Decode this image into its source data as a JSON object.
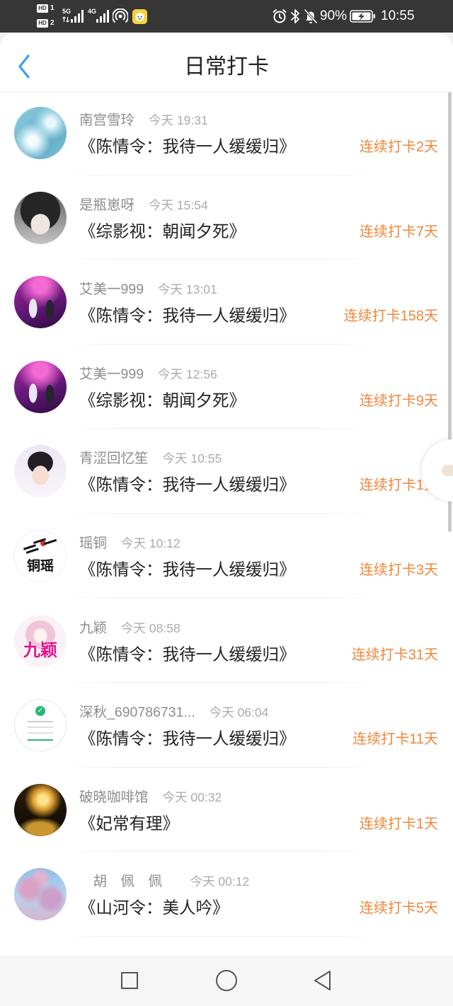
{
  "status_bar": {
    "sim1_badge": "HD",
    "sim1_number": "1",
    "sim2_badge": "HD",
    "sim2_number": "2",
    "sim1_network": "5G",
    "sim2_network": "4G",
    "battery_level": "90%",
    "clock": "10:55",
    "icons": [
      "signal-icon",
      "hotspot-icon",
      "app-notification-icon",
      "alarm-icon",
      "bluetooth-icon",
      "mute-icon",
      "battery-charging-icon"
    ]
  },
  "header": {
    "back_icon": "chevron-left-icon",
    "title": "日常打卡"
  },
  "items": [
    {
      "name": "南宫雪玲",
      "time": "今天 19:31",
      "book": "《陈情令：我待一人缓缓归》",
      "streak": "连续打卡2天"
    },
    {
      "name": "是瓶崽呀",
      "time": "今天 15:54",
      "book": "《综影视：朝闻夕死》",
      "streak": "连续打卡7天"
    },
    {
      "name": "艾美一999",
      "time": "今天 13:01",
      "book": "《陈情令：我待一人缓缓归》",
      "streak": "连续打卡158天"
    },
    {
      "name": "艾美一999",
      "time": "今天 12:56",
      "book": "《综影视：朝闻夕死》",
      "streak": "连续打卡9天"
    },
    {
      "name": "青涩回忆笙",
      "time": "今天 10:55",
      "book": "《陈情令：我待一人缓缓归》",
      "streak": "连续打卡1天"
    },
    {
      "name": "瑶铜",
      "time": "今天 10:12",
      "book": "《陈情令：我待一人缓缓归》",
      "streak": "连续打卡3天",
      "avatar_text": "铜瑶"
    },
    {
      "name": "九颖",
      "time": "今天 08:58",
      "book": "《陈情令：我待一人缓缓归》",
      "streak": "连续打卡31天",
      "avatar_text": "九颖"
    },
    {
      "name": "深秋_690786731...",
      "time": "今天 06:04",
      "book": "《陈情令：我待一人缓缓归》",
      "streak": "连续打卡11天"
    },
    {
      "name": "破晓咖啡馆",
      "time": "今天 00:32",
      "book": "《妃常有理》",
      "streak": "连续打卡1天"
    },
    {
      "name": "　胡　佩　佩　",
      "time": "今天 00:12",
      "book": "《山河令：美人吟》",
      "streak": "连续打卡5天"
    }
  ],
  "navigation_bar": {
    "icons": [
      "recent-apps-icon",
      "home-icon",
      "back-icon"
    ]
  },
  "colors": {
    "status_bar_bg": "#363636",
    "back_icon": "#3c9df2",
    "streak_text": "#f0863b",
    "title_text": "#222222",
    "name_text": "#8c8c8c",
    "time_text": "#ababab"
  }
}
